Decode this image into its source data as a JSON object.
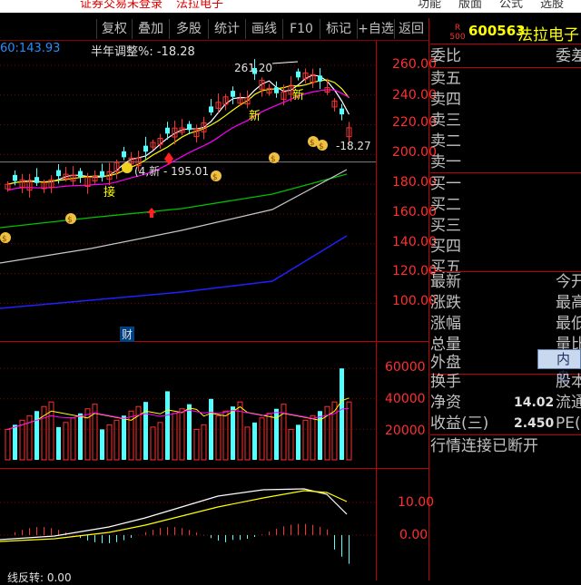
{
  "topbar": {
    "notice": "证券交易未登录",
    "stock_name": "法拉电子",
    "menu": [
      "功能",
      "版面",
      "公式",
      "选股"
    ]
  },
  "toolbar": {
    "buttons": [
      "复权",
      "叠加",
      "多股",
      "统计",
      "画线",
      "F10",
      "标记",
      "+自选",
      "返回"
    ]
  },
  "main_chart": {
    "current_price_label": "60:143.93",
    "annotation": "半年调整%: -18.28",
    "high_label": "261.20",
    "low_label": "-18.27",
    "ma_label": "(4,新 - 195.01",
    "markers": [
      "新",
      "新",
      "接",
      "财"
    ],
    "y_axis": [
      "260.00",
      "240.00",
      "220.00",
      "200.00",
      "180.00",
      "160.00",
      "140.00",
      "120.00",
      "100.00"
    ]
  },
  "volume_chart": {
    "y_axis": [
      "60000",
      "40000",
      "20000"
    ]
  },
  "macd_chart": {
    "y_axis": [
      "10.00",
      "0.00"
    ],
    "bottom_label": "线反转: 0.00"
  },
  "right_panel": {
    "badge_top": "R",
    "badge_bottom": "500",
    "code": "600563",
    "name": "法拉电子",
    "weibi": "委比",
    "weicha": "委差",
    "sells": [
      "卖五",
      "卖四",
      "卖三",
      "卖二",
      "卖一"
    ],
    "buys": [
      "买一",
      "买二",
      "买三",
      "买四",
      "买五"
    ],
    "stats_left": [
      "最新",
      "涨跌",
      "涨幅",
      "总量",
      "外盘"
    ],
    "stats_right": [
      "今开",
      "最高",
      "最低",
      "量比",
      "内盘"
    ],
    "huanshou": "换手",
    "guben": "股本",
    "jingzi_label": "净资",
    "jingzi_value": "14.02",
    "liutong": "流通",
    "shouyi_label": "收益(三)",
    "shouyi_value": "2.450",
    "pe": "PE(动)",
    "status": "行情连接已断开"
  },
  "colors": {
    "up": "#ff3030",
    "down": "#54ffff",
    "ma_white": "#ffffff",
    "ma_yellow": "#ffff00",
    "ma_magenta": "#ff00ff",
    "ma_green": "#00c000",
    "ma_blue": "#2020ff",
    "grid": "#8b0000"
  }
}
